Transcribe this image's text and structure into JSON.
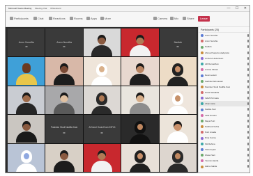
{
  "window": {
    "tabs": [
      "Microsoft Teams Meeting",
      "Meeting chat",
      "Whiteboard"
    ],
    "controls": "— ☐ ✕"
  },
  "toolbar": {
    "items": [
      "Participants",
      "Chat",
      "Reactions",
      "Rooms",
      "Apps",
      "More",
      "Camera",
      "Mic",
      "Share",
      "Leave"
    ]
  },
  "grid": {
    "tiles": [
      {
        "type": "name",
        "label": "Annn Nurulfia"
      },
      {
        "type": "name",
        "label": "Annn Nurulfia"
      },
      {
        "type": "video",
        "bg": "#d9d9d9",
        "skin": "#8a5a40",
        "top": "#2a2a2a",
        "variant": "hair"
      },
      {
        "type": "video",
        "bg": "#c8282e",
        "skin": "#b07a55",
        "top": "#f2f2f2",
        "variant": "hair"
      },
      {
        "type": "name",
        "label": "Nadiah"
      },
      {
        "type": "video",
        "bg": "#3fa0d8",
        "skin": "#6a3a22",
        "top": "#e8c64a",
        "variant": "cartoon"
      },
      {
        "type": "video",
        "bg": "#d8b8a8",
        "skin": "#7a4a35",
        "top": "#1d1d1d",
        "variant": "hair"
      },
      {
        "type": "video",
        "bg": "#efe5da",
        "skin": "#d9b08a",
        "top": "#ffffff",
        "variant": "hijab"
      },
      {
        "type": "video",
        "bg": "#e8d8cf",
        "skin": "#b98563",
        "top": "#1e1e1e",
        "variant": "hair"
      },
      {
        "type": "video",
        "bg": "#eddcc6",
        "skin": "#c9906a",
        "top": "#222222",
        "variant": "hijab"
      },
      {
        "type": "video",
        "bg": "#c9ccd2",
        "skin": "#9d6a4a",
        "top": "#262626",
        "variant": "hair"
      },
      {
        "type": "video",
        "bg": "#a8a8aa",
        "skin": "#e0c0a0",
        "top": "#5a5a5a",
        "variant": "hair"
      },
      {
        "type": "video",
        "bg": "#dcd8d4",
        "skin": "#b07a55",
        "top": "#2a2a2a",
        "variant": "hijab"
      },
      {
        "type": "video",
        "bg": "#e9e5de",
        "skin": "#d6ad88",
        "top": "#8d8d8d",
        "variant": "hair"
      },
      {
        "type": "video",
        "bg": "#efe6dd",
        "skin": "#c6916a",
        "top": "#ffffff",
        "variant": "hijab"
      },
      {
        "type": "video",
        "bg": "#cac6c1",
        "skin": "#8a5a40",
        "top": "#1a1a1a",
        "variant": "hair"
      },
      {
        "type": "name",
        "label": "Pasinlan Studi Nadifia Kasi"
      },
      {
        "type": "name",
        "label": "Al Nurul Huda Evan 23F13"
      },
      {
        "type": "video",
        "bg": "#2a2a2a",
        "skin": "#c08860",
        "top": "#111111",
        "variant": "hijab"
      },
      {
        "type": "video",
        "bg": "#ece4da",
        "skin": "#c9906a",
        "top": "#ffffff",
        "variant": "hair"
      },
      {
        "type": "video",
        "bg": "#b9c4d6",
        "skin": "#8fa8e0",
        "top": "#ffffff",
        "variant": "hijab"
      },
      {
        "type": "video",
        "bg": "#d8d0c6",
        "skin": "#8a5a40",
        "top": "#1c1c1c",
        "variant": "hair"
      },
      {
        "type": "video",
        "bg": "#c8282e",
        "skin": "#b07a55",
        "top": "#f2f2f2",
        "variant": "hair"
      },
      {
        "type": "video",
        "bg": "#e8e0d8",
        "skin": "#c9906a",
        "top": "#202020",
        "variant": "hijab"
      },
      {
        "type": "video",
        "bg": "#ddd6cf",
        "skin": "#c08860",
        "top": "#2a2a2a",
        "variant": "hijab"
      }
    ]
  },
  "panel": {
    "title": "Participants (25)",
    "rows": [
      {
        "name": "Annn Nurulfia",
        "color": "#5b7bd5"
      },
      {
        "name": "Annn Nurulfia",
        "color": "#d46a6a"
      },
      {
        "name": "Nadiah",
        "color": "#6aa86a"
      },
      {
        "name": "Ahmad Saputra Hadiyanto",
        "color": "#c98c3a"
      },
      {
        "name": "Al Nurul Huda Evan",
        "color": "#8a6ad4"
      },
      {
        "name": "Alif Ramadhan",
        "color": "#3aa8a8"
      },
      {
        "name": "Annisa Fitriani",
        "color": "#d46aa8"
      },
      {
        "name": "Dewi Lestari",
        "color": "#5b7bd5"
      },
      {
        "name": "Fadhila Rahmawati",
        "color": "#6aa86a"
      },
      {
        "name": "Pasinlan Studi Nadifia Kasi",
        "color": "#c98c3a"
      },
      {
        "name": "Hana Salsabila",
        "color": "#d46a6a"
      },
      {
        "name": "Indah Permata",
        "color": "#8a6ad4"
      },
      {
        "name": "Jihan Aulia",
        "color": "#3aa8a8",
        "selected": true
      },
      {
        "name": "Kartika Sari",
        "color": "#5b7bd5"
      },
      {
        "name": "Laila Nuraini",
        "color": "#d46aa8"
      },
      {
        "name": "Maya Putri",
        "color": "#6aa86a"
      },
      {
        "name": "Nabila Azzahra",
        "color": "#c98c3a"
      },
      {
        "name": "Putri Amalia",
        "color": "#d46a6a"
      },
      {
        "name": "Rina Kurnia",
        "color": "#8a6ad4"
      },
      {
        "name": "Siti Rahma",
        "color": "#3aa8a8"
      },
      {
        "name": "Tiara Anjani",
        "color": "#5b7bd5"
      },
      {
        "name": "Wulan Sari",
        "color": "#6aa86a"
      },
      {
        "name": "Yasmin Hanifa",
        "color": "#d46aa8"
      },
      {
        "name": "Zahra Nabila",
        "color": "#c98c3a"
      }
    ]
  }
}
